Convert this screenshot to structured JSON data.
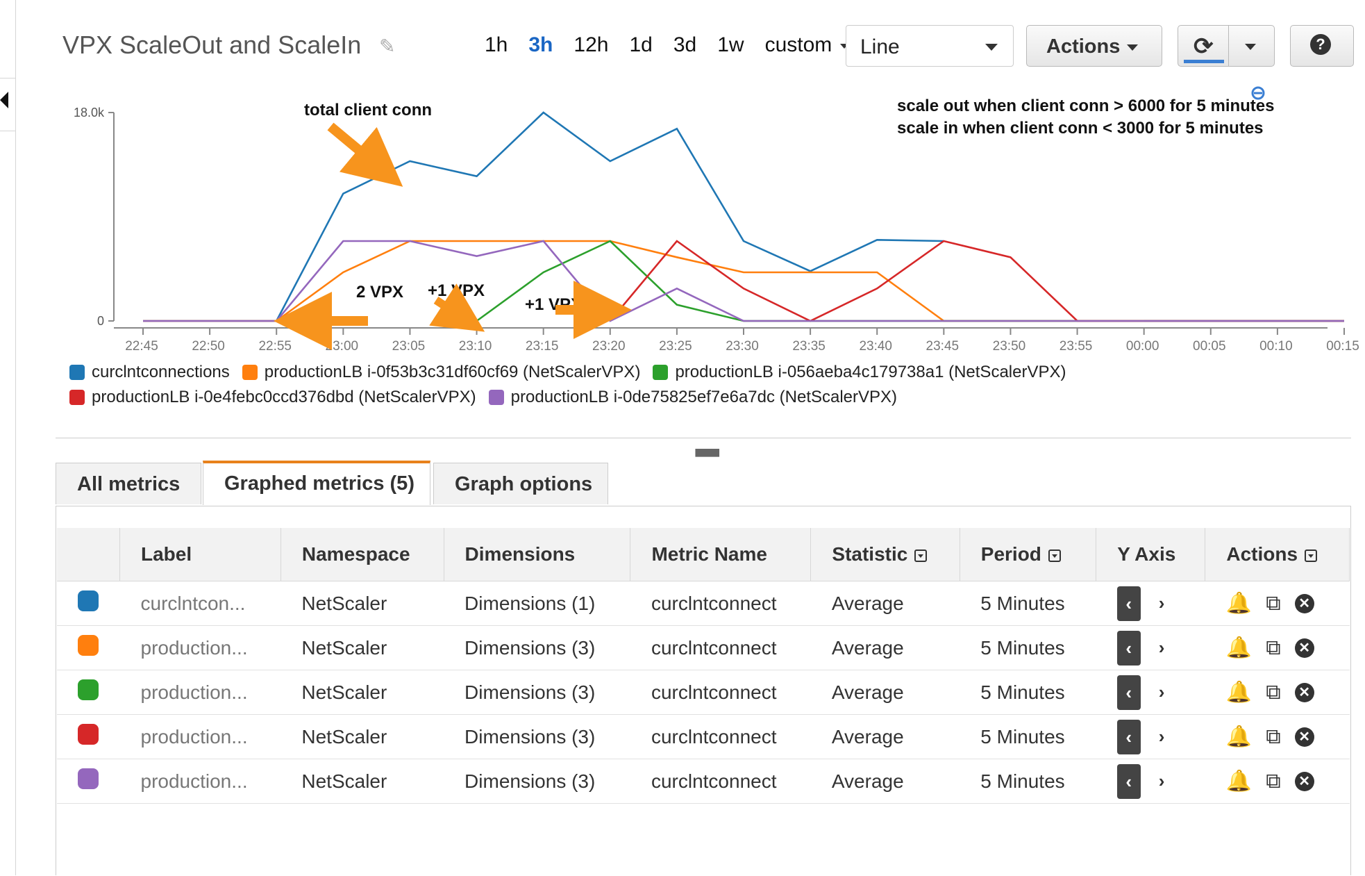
{
  "title": "VPX ScaleOut and ScaleIn",
  "time_ranges": [
    "1h",
    "3h",
    "12h",
    "1d",
    "3d",
    "1w",
    "custom"
  ],
  "active_range": "3h",
  "view_select": "Line",
  "actions_label": "Actions",
  "annotations": {
    "total": "total client conn",
    "rule1": "scale out when client conn > 6000 for 5 minutes",
    "rule2": "scale in when client conn < 3000 for 5 minutes",
    "vpx2": "2 VPX",
    "vpx_plus1_a": "+1 VPX",
    "vpx_plus1_b": "+1 VPX"
  },
  "legend": [
    {
      "name": "curclntconnections",
      "color": "#1f77b4"
    },
    {
      "name": "productionLB i-0f53b3c31df60cf69 (NetScalerVPX)",
      "color": "#ff7f0e"
    },
    {
      "name": "productionLB i-056aeba4c179738a1 (NetScalerVPX)",
      "color": "#2ca02c"
    },
    {
      "name": "productionLB i-0e4febc0ccd376dbd (NetScalerVPX)",
      "color": "#d62728"
    },
    {
      "name": "productionLB i-0de75825ef7e6a7dc (NetScalerVPX)",
      "color": "#9467bd"
    }
  ],
  "tabs": [
    "All metrics",
    "Graphed metrics (5)",
    "Graph options"
  ],
  "table": {
    "headers": [
      "Label",
      "Namespace",
      "Dimensions",
      "Metric Name",
      "Statistic",
      "Period",
      "Y Axis",
      "Actions"
    ],
    "rows": [
      {
        "color": "#1f77b4",
        "label": "curclntcon...",
        "namespace": "NetScaler",
        "dimensions": "Dimensions (1)",
        "metric": "curclntconnect",
        "statistic": "Average",
        "period": "5 Minutes"
      },
      {
        "color": "#ff7f0e",
        "label": "production...",
        "namespace": "NetScaler",
        "dimensions": "Dimensions (3)",
        "metric": "curclntconnect",
        "statistic": "Average",
        "period": "5 Minutes"
      },
      {
        "color": "#2ca02c",
        "label": "production...",
        "namespace": "NetScaler",
        "dimensions": "Dimensions (3)",
        "metric": "curclntconnect",
        "statistic": "Average",
        "period": "5 Minutes"
      },
      {
        "color": "#d62728",
        "label": "production...",
        "namespace": "NetScaler",
        "dimensions": "Dimensions (3)",
        "metric": "curclntconnect",
        "statistic": "Average",
        "period": "5 Minutes"
      },
      {
        "color": "#9467bd",
        "label": "production...",
        "namespace": "NetScaler",
        "dimensions": "Dimensions (3)",
        "metric": "curclntconnect",
        "statistic": "Average",
        "period": "5 Minutes"
      }
    ]
  },
  "chart_data": {
    "type": "line",
    "y_ticks": [
      "18.0k",
      "0"
    ],
    "ylim": [
      0,
      18000
    ],
    "categories": [
      "22:45",
      "22:50",
      "22:55",
      "23:00",
      "23:05",
      "23:10",
      "23:15",
      "23:20",
      "23:25",
      "23:30",
      "23:35",
      "23:40",
      "23:45",
      "23:50",
      "23:55",
      "00:00",
      "00:05",
      "00:10",
      "00:15"
    ],
    "x_ticks": [
      "22:45",
      "22:50",
      "22:55",
      "23:00",
      "23:05",
      "23:10",
      "23:15",
      "23:20",
      "23:25",
      "23:30",
      "23:35",
      "23:40",
      "23:45",
      "23:50",
      "23:55",
      "00:00",
      "00:05",
      "00:10",
      "00:15"
    ],
    "series": [
      {
        "name": "curclntconnections",
        "color": "#1f77b4",
        "values": [
          0,
          0,
          0,
          11000,
          13800,
          12500,
          18000,
          13800,
          16600,
          6900,
          4300,
          7000,
          6900,
          null,
          null,
          0,
          0,
          0,
          0
        ]
      },
      {
        "name": "productionLB i-0f53b3c31df60cf69 (NetScalerVPX)",
        "color": "#ff7f0e",
        "values": [
          0,
          0,
          0,
          4200,
          6900,
          6900,
          6900,
          6900,
          5500,
          4200,
          4200,
          4200,
          0,
          0,
          0,
          0,
          0,
          0,
          0
        ]
      },
      {
        "name": "productionLB i-056aeba4c179738a1 (NetScalerVPX)",
        "color": "#2ca02c",
        "values": [
          null,
          null,
          null,
          null,
          null,
          0,
          4200,
          6900,
          1400,
          0,
          0,
          0,
          0,
          0,
          0,
          0,
          0,
          0,
          0
        ]
      },
      {
        "name": "productionLB i-0e4febc0ccd376dbd (NetScalerVPX)",
        "color": "#d62728",
        "values": [
          null,
          null,
          null,
          null,
          null,
          null,
          null,
          0,
          6900,
          2800,
          0,
          2800,
          6900,
          5500,
          0,
          0,
          0,
          0,
          0
        ]
      },
      {
        "name": "productionLB i-0de75825ef7e6a7dc (NetScalerVPX)",
        "color": "#9467bd",
        "values": [
          0,
          0,
          0,
          6900,
          6900,
          5600,
          6900,
          0,
          2800,
          0,
          0,
          0,
          0,
          0,
          0,
          0,
          0,
          0,
          0
        ]
      }
    ]
  }
}
